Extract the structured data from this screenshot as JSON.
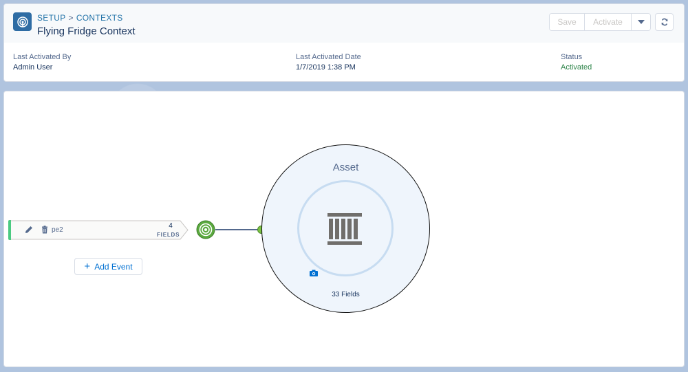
{
  "breadcrumb": {
    "setup": "SETUP",
    "separator": ">",
    "contexts": "CONTEXTS"
  },
  "page_title": "Flying Fridge Context",
  "toolbar": {
    "save_label": "Save",
    "activate_label": "Activate"
  },
  "meta": {
    "last_activated_by_label": "Last Activated By",
    "last_activated_by": "Admin User",
    "last_activated_date_label": "Last Activated Date",
    "last_activated_date": "1/7/2019 1:38 PM",
    "status_label": "Status",
    "status": "Activated"
  },
  "event": {
    "name": "pe2",
    "field_count": "4",
    "fields_label": "FIELDS"
  },
  "add_event_label": "Add Event",
  "asset": {
    "title": "Asset",
    "fields": "33 Fields"
  },
  "colors": {
    "brand": "#2e6ca4",
    "link": "#2574a9",
    "status_active": "#2e844a",
    "event_accent": "#4bca81",
    "asset_fill": "#eff5fc"
  },
  "icons": {
    "context": "context-icon",
    "edit": "pencil-icon",
    "delete": "trash-icon",
    "connector": "broadcast-icon",
    "asset": "pillars-icon",
    "camera": "camera-icon",
    "dropdown": "chevron-down-icon",
    "settings": "sync-icon"
  }
}
